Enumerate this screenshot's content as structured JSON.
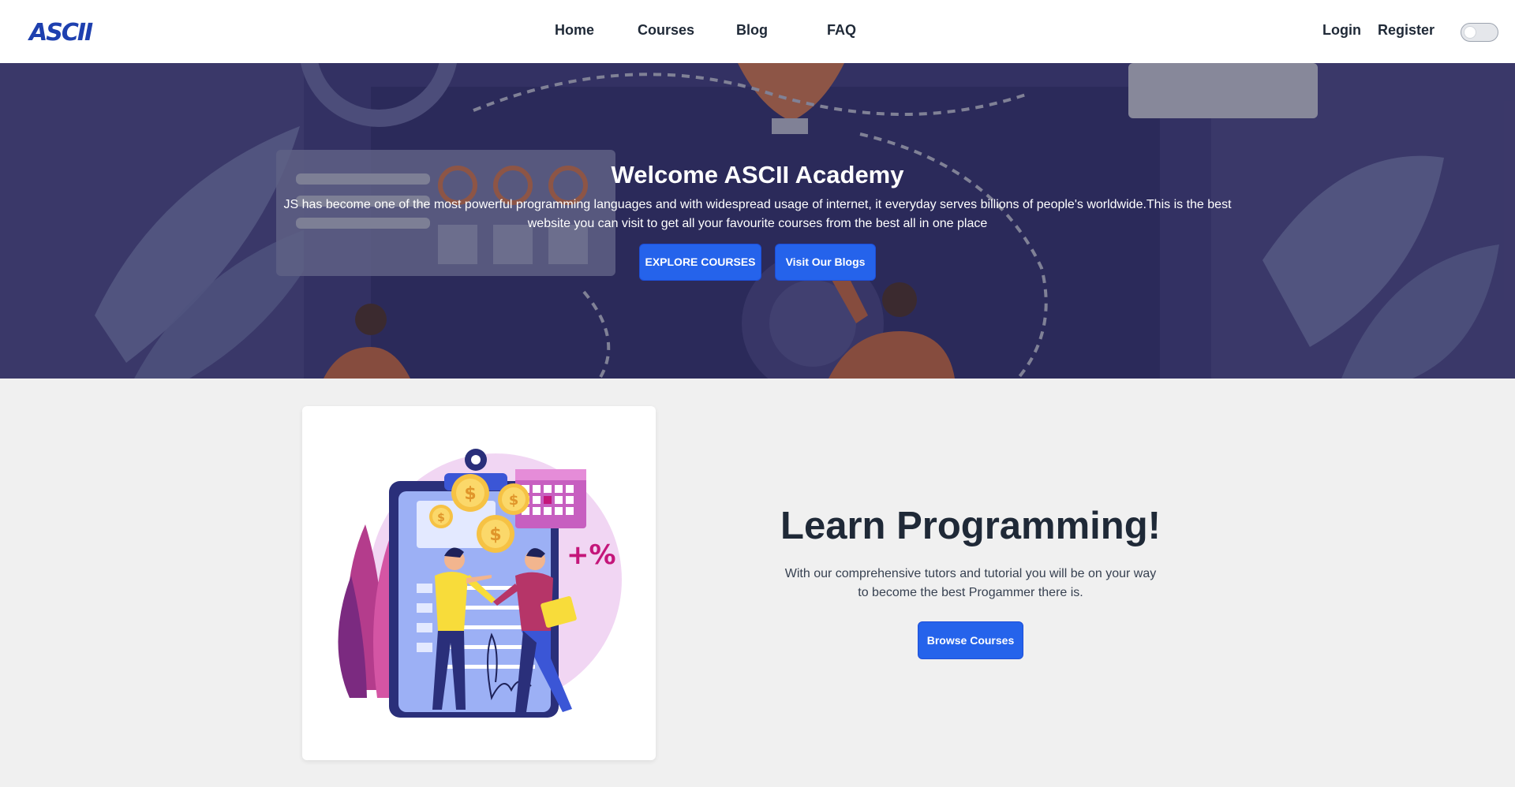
{
  "nav": {
    "logo": "ASCII",
    "links": [
      "Home",
      "Courses",
      "Blog",
      "FAQ"
    ],
    "login": "Login",
    "register": "Register"
  },
  "hero": {
    "title": "Welcome ASCII Academy",
    "text": "JS has become one of the most powerful programming languages and with widespread usage of internet, it everyday serves billions of people's worldwide.This is the best website you can visit to get all your favourite courses from the best all in one place",
    "explore_button": "EXPLORE COURSES",
    "blogs_button": "Visit Our Blogs"
  },
  "feature": {
    "title": "Learn Programming!",
    "text": "With our comprehensive tutors and tutorial you will be on your way to become the best Progammer there is.",
    "browse_button": "Browse Courses",
    "illustration_text": "+%"
  },
  "colors": {
    "brand": "#1e40af",
    "button": "#2563eb",
    "hero_bg": "#3d3a86"
  }
}
